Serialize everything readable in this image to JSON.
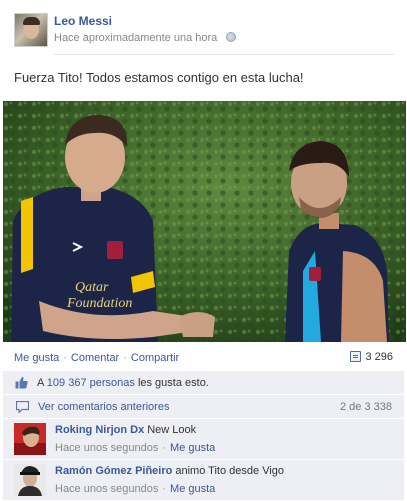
{
  "post": {
    "author": "Leo Messi",
    "timestamp": "Hace aproximadamente una hora",
    "message": "Fuerza Tito! Todos estamos contigo en esta lucha!"
  },
  "photo": {
    "shirt_text_line1": "Qatar",
    "shirt_text_line2": "Foundation"
  },
  "actions": {
    "like": "Me gusta",
    "comment": "Comentar",
    "share": "Compartir",
    "separator": "·",
    "shares_count": "3 296"
  },
  "likes": {
    "prefix": "A",
    "people": "109 367 personas",
    "suffix": "les gusta esto."
  },
  "previous_comments": {
    "label": "Ver comentarios anteriores",
    "count": "2 de 3 338"
  },
  "comments": [
    {
      "author": "Roking Nirjon Dx",
      "text": "New Look",
      "time": "Hace unos segundos",
      "like": "Me gusta"
    },
    {
      "author": "Ramón Gómez Piñeiro",
      "text": "animo Tito desde Vigo",
      "time": "Hace unos segundos",
      "like": "Me gusta"
    }
  ],
  "colors": {
    "link": "#3b5998",
    "ufi_background": "#edeff4",
    "meta_text": "#888888",
    "jersey_navy": "#1c2548",
    "jersey_yellow": "#f2c500",
    "tank_cyan": "#22a9df"
  },
  "icons": {
    "audience": "globe-icon",
    "shares": "share-icon",
    "likes": "thumbs-up-icon",
    "comments": "comment-bubble-icon"
  }
}
